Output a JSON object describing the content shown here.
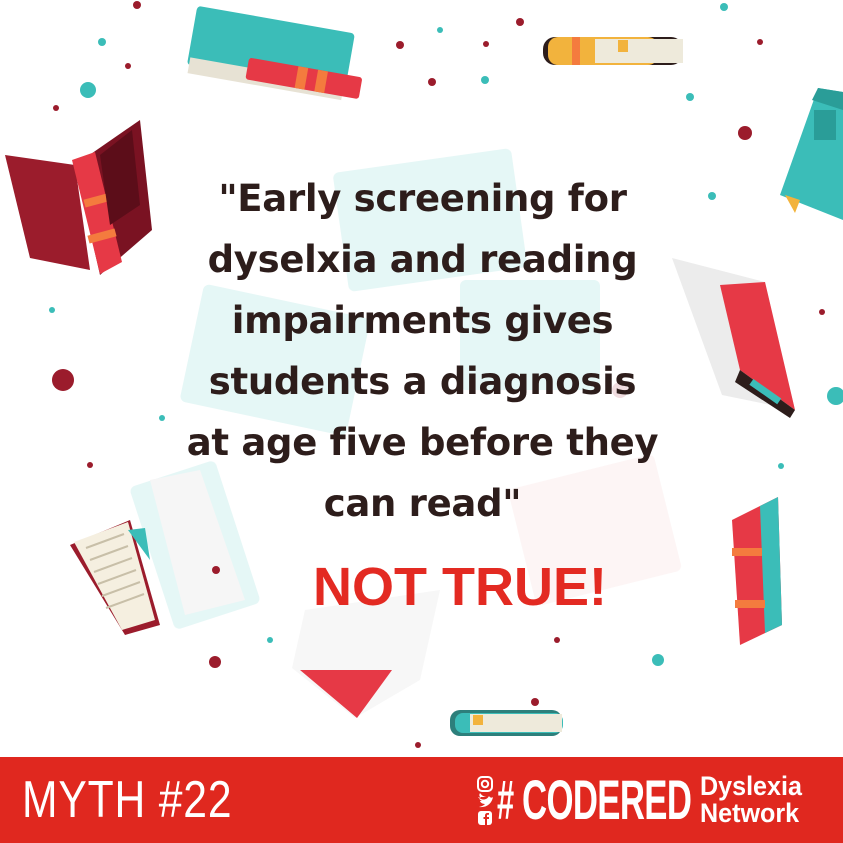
{
  "quote": {
    "lines": [
      "\"Early screening for",
      "dyselxia and reading",
      "impairments gives",
      "students a diagnosis",
      "at age five before they",
      "can read\""
    ]
  },
  "verdict": "NOT TRUE!",
  "footer": {
    "myth_label": "MYTH #22",
    "hashtag": "#",
    "brand": "CODERED",
    "org_name": "Dyslexia\nNetwork"
  },
  "icons": [
    "instagram-icon",
    "twitter-icon",
    "facebook-icon",
    "book-icon",
    "exclamation-mark-icon"
  ],
  "colors": {
    "accent_red": "#e0281f",
    "text_dark": "#2d1d1b",
    "teal": "#3bbdb8",
    "maroon": "#9b1c2c",
    "book_red": "#e63946",
    "orange": "#f47b3e"
  }
}
